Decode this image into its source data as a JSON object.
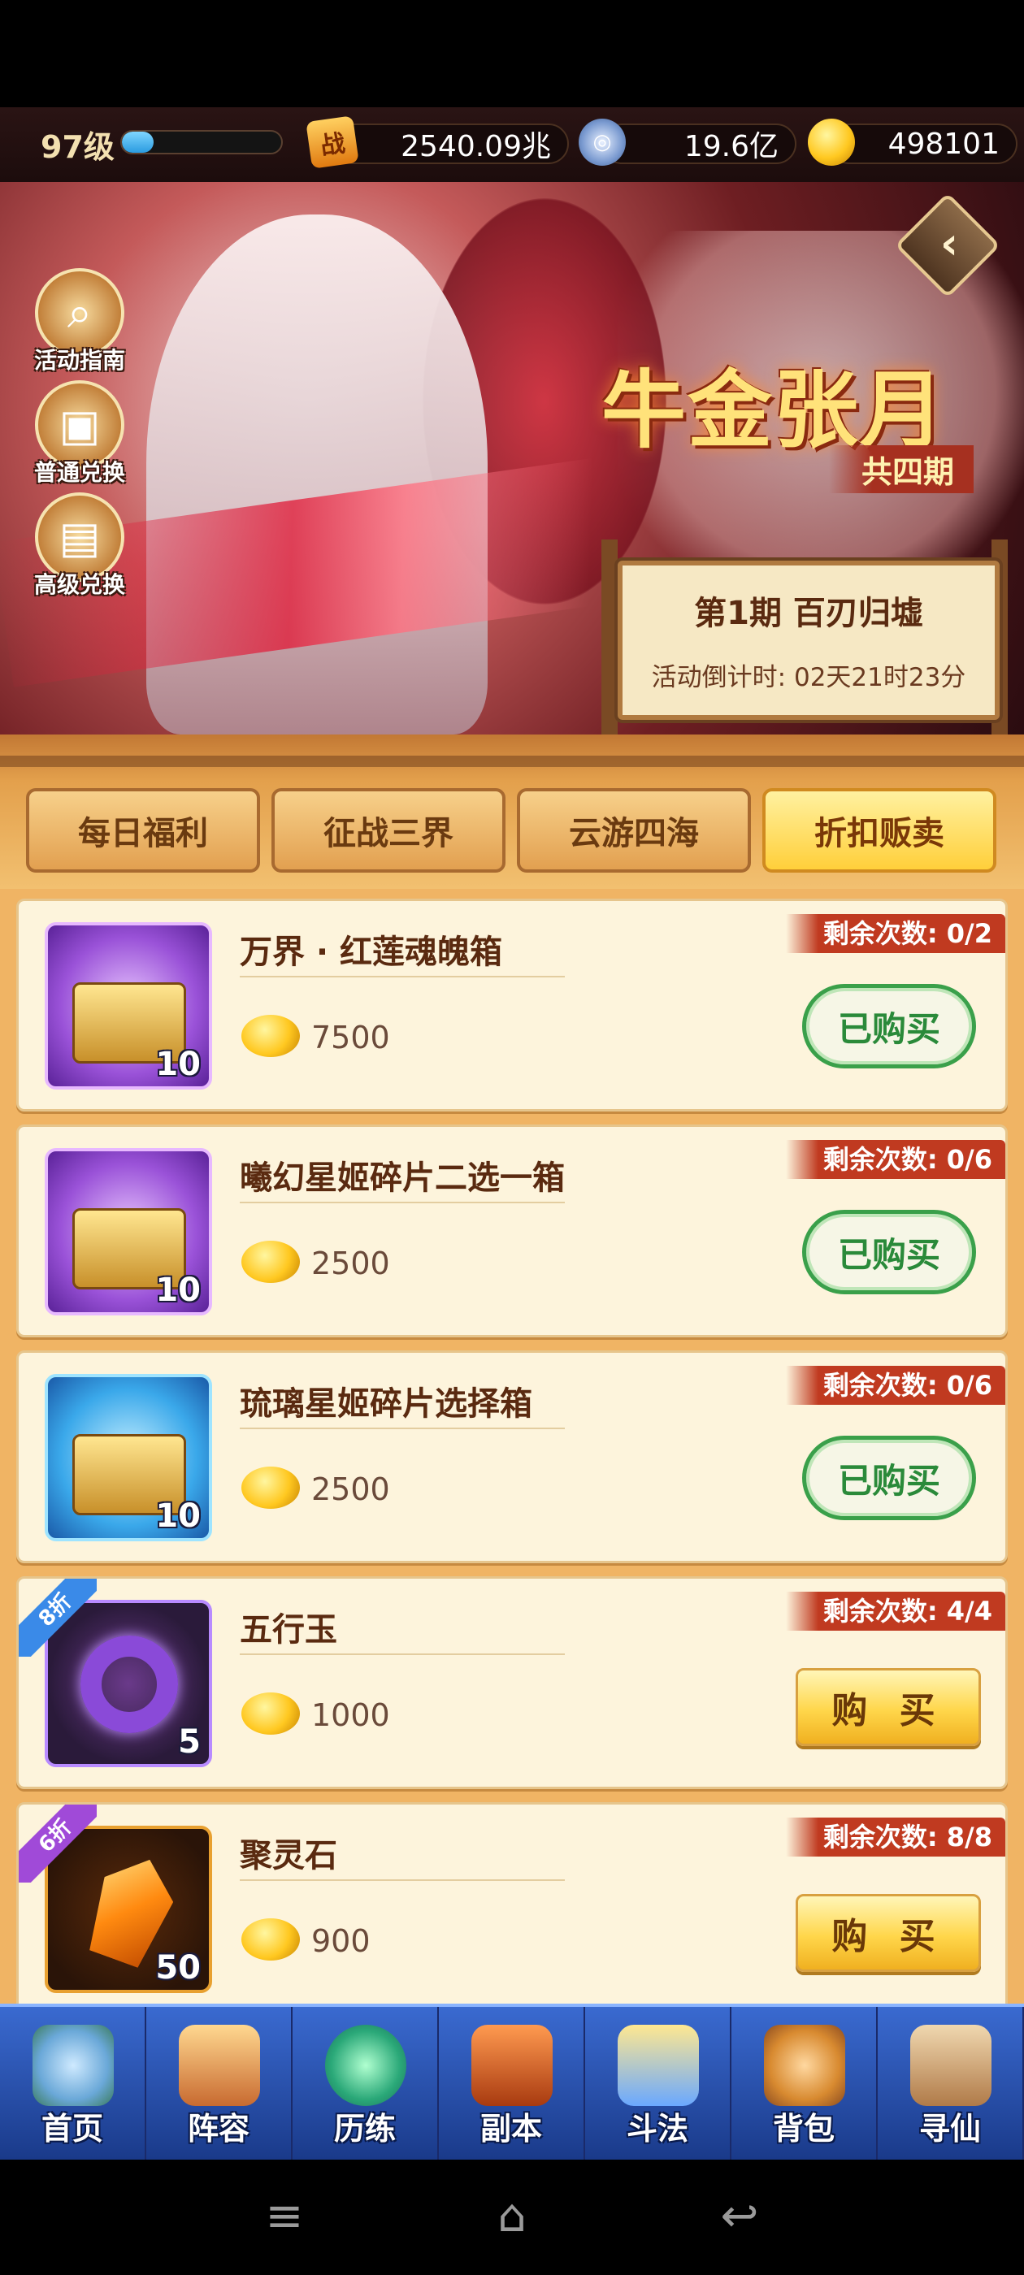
{
  "top_bar": {
    "level": "97级",
    "level_progress": 0.2,
    "power_icon": "战",
    "power": "2540.09兆",
    "silver": "19.6亿",
    "gold": "498101"
  },
  "banner": {
    "title": "牛金张月",
    "subtitle": "共四期",
    "period": "第1期  百刃归墟",
    "countdown": "活动倒计时: 02天21时23分",
    "side_buttons": [
      "活动指南",
      "普通兑换",
      "高级兑换"
    ]
  },
  "tabs": [
    "每日福利",
    "征战三界",
    "云游四海",
    "折扣贩卖"
  ],
  "active_tab": 3,
  "items": [
    {
      "name": "万界 · 红莲魂魄箱",
      "count": "10",
      "price": "7500",
      "remain": "剩余次数: 0/2",
      "button": "已购买",
      "state": "bought"
    },
    {
      "name": "曦幻星姬碎片二选一箱",
      "count": "10",
      "price": "2500",
      "remain": "剩余次数: 0/6",
      "button": "已购买",
      "state": "bought"
    },
    {
      "name": "琉璃星姬碎片选择箱",
      "count": "10",
      "price": "2500",
      "remain": "剩余次数: 0/6",
      "button": "已购买",
      "state": "bought"
    },
    {
      "name": "五行玉",
      "count": "5",
      "price": "1000",
      "remain": "剩余次数: 4/4",
      "button": "购 买",
      "state": "buy",
      "discount": "8折"
    },
    {
      "name": "聚灵石",
      "count": "50",
      "price": "900",
      "remain": "剩余次数: 8/8",
      "button": "购 买",
      "state": "buy",
      "discount": "6折"
    }
  ],
  "bottom_nav": [
    "首页",
    "阵容",
    "历练",
    "副本",
    "斗法",
    "背包",
    "寻仙"
  ],
  "system_nav": {
    "menu": "≡",
    "home": "⌂",
    "back": "↩"
  }
}
